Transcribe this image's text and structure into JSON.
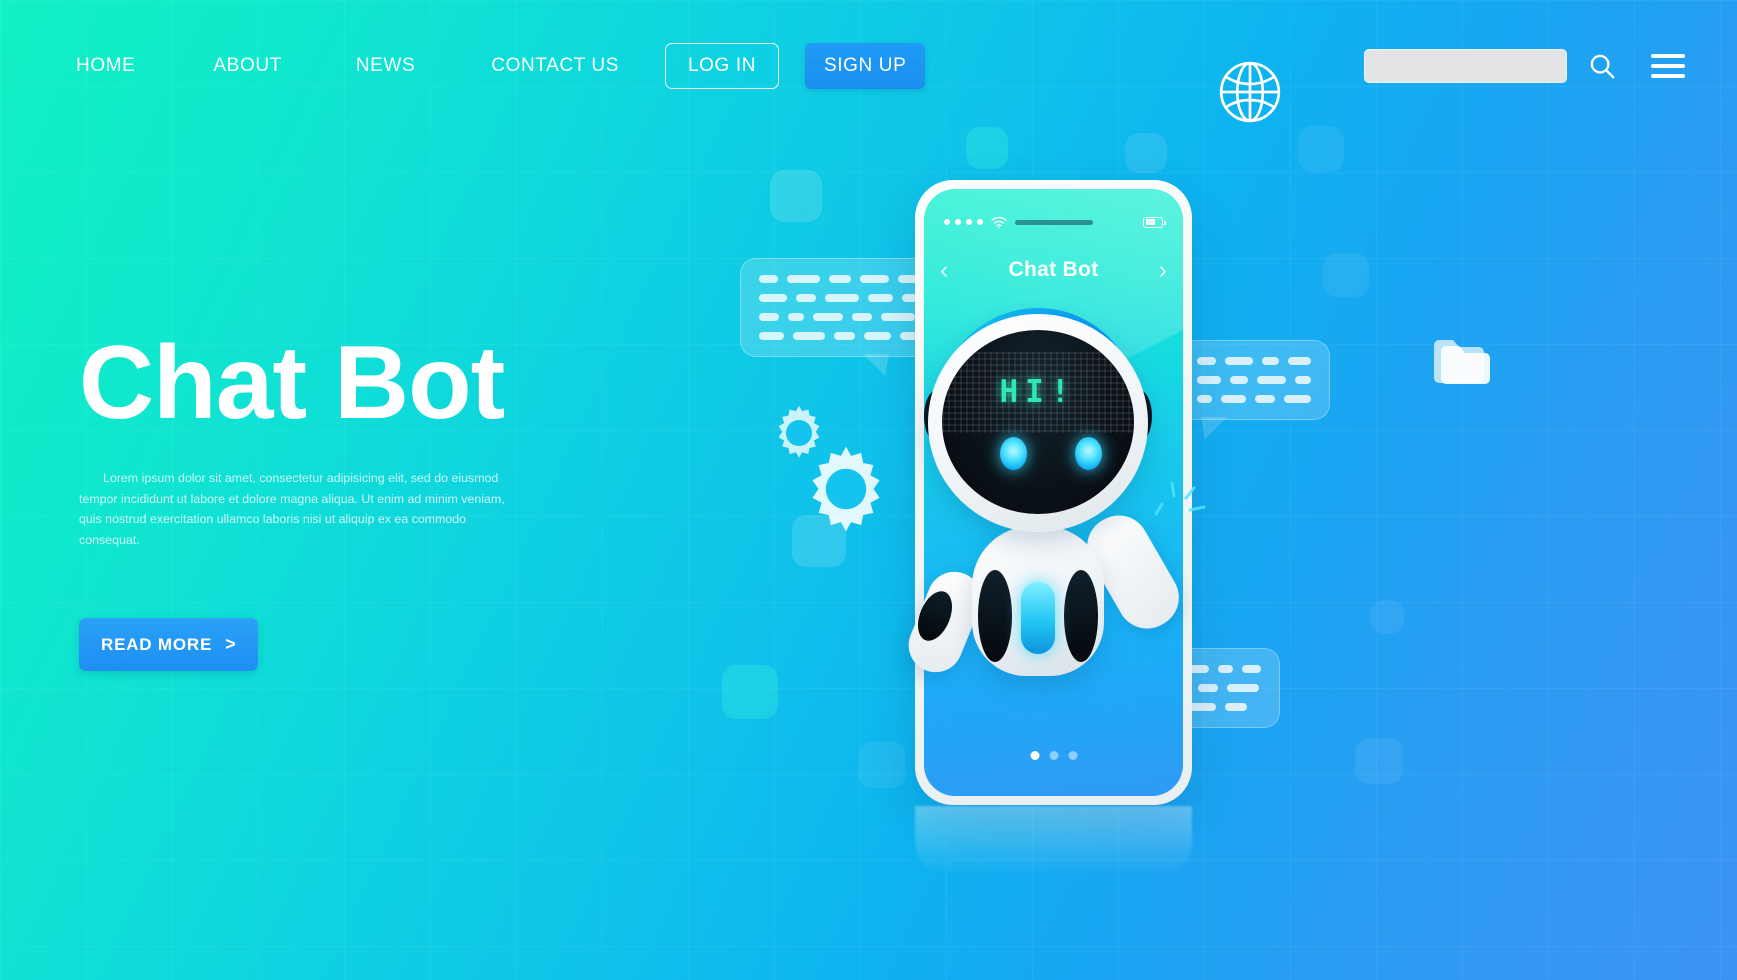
{
  "header": {
    "nav": [
      {
        "label": "HOME",
        "name": "nav-home"
      },
      {
        "label": "ABOUT",
        "name": "nav-about"
      },
      {
        "label": "NEWS",
        "name": "nav-news"
      },
      {
        "label": "CONTACT US",
        "name": "nav-contact-us"
      }
    ],
    "login_label": "LOG IN",
    "signup_label": "SIGN UP",
    "search_placeholder": "",
    "search_value": ""
  },
  "hero": {
    "title": "Chat Bot",
    "paragraph": "Lorem ipsum dolor sit amet, consectetur adipisicing elit, sed do eiusmod tempor incididunt ut labore et dolore magna aliqua. Ut enim ad minim veniam, quis nostrud exercitation ullamco laboris nisi ut aliquip ex ea commodo consequat.",
    "cta_label": "READ MORE",
    "cta_chevron": ">"
  },
  "phone": {
    "chat_title": "Chat Bot",
    "back_chevron": "‹",
    "forward_chevron": "›",
    "robot_display_text": "HI!",
    "page_dots": [
      true,
      false,
      false
    ]
  },
  "colors": {
    "gradient_start": "#12f0c4",
    "gradient_end": "#3d93f4",
    "button_blue": "#1d8ef2",
    "robot_eye": "#4fe3ff",
    "led_green": "#2ee7b8",
    "search_fill": "#e3e4e6"
  },
  "icons": {
    "search": "search-icon",
    "menu": "hamburger-menu-icon",
    "globe": "globe-icon",
    "folder": "folder-icon",
    "wifi": "wifi-icon",
    "battery": "battery-icon",
    "gear": "gear-icon"
  }
}
